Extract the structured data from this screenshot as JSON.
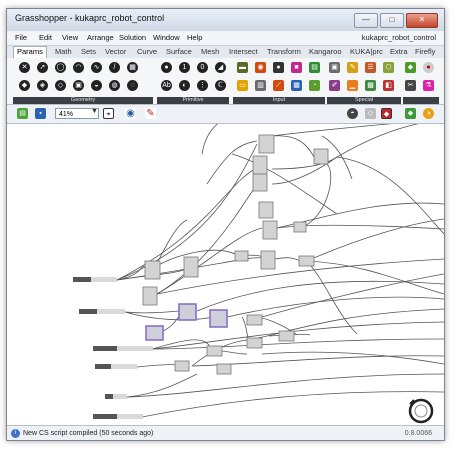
{
  "window": {
    "title": "Grasshopper - kukaprc_robot_control",
    "minimize": "—",
    "maximize": "□",
    "close": "✕"
  },
  "menu": {
    "items": [
      "File",
      "Edit",
      "View",
      "Arrange",
      "Solution",
      "Window",
      "Help"
    ],
    "document_name": "kukaprc_robot_control"
  },
  "tabs": [
    "Params",
    "Math",
    "Sets",
    "Vector",
    "Curve",
    "Surface",
    "Mesh",
    "Intersect",
    "Transform",
    "Kangaroo",
    "KUKA|prc",
    "Extra",
    "Firefly"
  ],
  "active_tab": "Params",
  "ribbon": {
    "groups": [
      "Geometry",
      "Primitive",
      "Input",
      "Special"
    ]
  },
  "toolbar": {
    "zoom": "41%"
  },
  "status": {
    "message": "New CS script compiled (50 seconds ago)",
    "version": "0.8.0066"
  },
  "colors": {
    "window_frame": "#7b8593",
    "canvas": "#ffffff",
    "component": "#d3d3d3",
    "selected_component": "#9a7ed3",
    "wire": "#555555",
    "group_label_bg": "#3a3f45"
  }
}
